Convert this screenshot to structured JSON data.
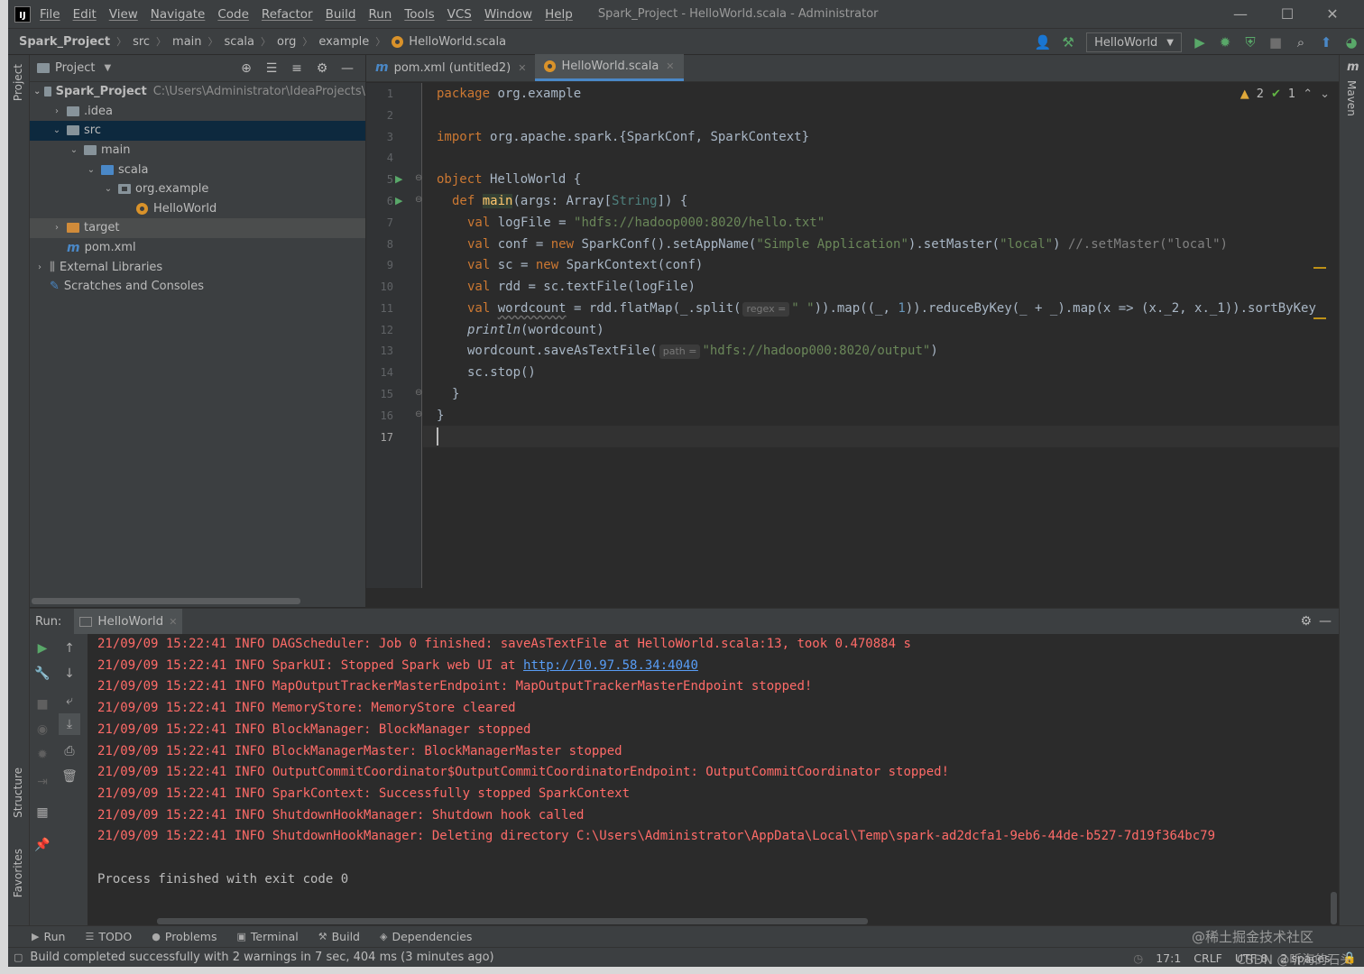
{
  "window": {
    "title": "Spark_Project - HelloWorld.scala - Administrator",
    "menu": [
      "File",
      "Edit",
      "View",
      "Navigate",
      "Code",
      "Refactor",
      "Build",
      "Run",
      "Tools",
      "VCS",
      "Window",
      "Help"
    ],
    "controls": {
      "minimize": "—",
      "maximize": "☐",
      "close": "✕"
    }
  },
  "breadcrumb": [
    "Spark_Project",
    "src",
    "main",
    "scala",
    "org",
    "example",
    "HelloWorld.scala"
  ],
  "toolbar": {
    "run_config": "HelloWorld"
  },
  "side_strips": {
    "left_top": "Project",
    "left_structure": "Structure",
    "left_favorites": "Favorites",
    "right": "Maven"
  },
  "project": {
    "title": "Project",
    "tree": [
      {
        "label": "Spark_Project",
        "path": "C:\\Users\\Administrator\\IdeaProjects\\"
      },
      {
        "label": ".idea"
      },
      {
        "label": "src"
      },
      {
        "label": "main"
      },
      {
        "label": "scala"
      },
      {
        "label": "org.example"
      },
      {
        "label": "HelloWorld"
      },
      {
        "label": "target"
      },
      {
        "label": "pom.xml"
      },
      {
        "label": "External Libraries"
      },
      {
        "label": "Scratches and Consoles"
      }
    ]
  },
  "editor": {
    "tabs": [
      {
        "label": "pom.xml (untitled2)"
      },
      {
        "label": "HelloWorld.scala"
      }
    ],
    "line_numbers": [
      "1",
      "2",
      "3",
      "4",
      "5",
      "6",
      "7",
      "8",
      "9",
      "10",
      "11",
      "12",
      "13",
      "14",
      "15",
      "16",
      "17"
    ],
    "inspections": {
      "warnings": "2",
      "ok": "1"
    },
    "code": {
      "l1a": "package",
      "l1b": " org.example",
      "l3a": "import",
      "l3b": " org.apache.spark.{SparkConf, SparkContext}",
      "l5a": "object",
      "l5b": " HelloWorld {",
      "l6a": "def",
      "l6b": "main",
      "l6c": "(args: Array[",
      "l6d": "String",
      "l6e": "]) {",
      "l7a": "val",
      "l7b": " logFile = ",
      "l7c": "\"hdfs://hadoop000:8020/hello.txt\"",
      "l8a": "val",
      "l8b": " conf = ",
      "l8c": "new",
      "l8d": " SparkConf().setAppName(",
      "l8e": "\"Simple Application\"",
      "l8f": ").setMaster(",
      "l8g": "\"local\"",
      "l8h": ") ",
      "l8i": "//.setMaster(\"local\")",
      "l9a": "val",
      "l9b": " sc = ",
      "l9c": "new",
      "l9d": " SparkContext(conf)",
      "l10a": "val",
      "l10b": " rdd = sc.textFile(logFile)",
      "l11a": "val",
      "l11b": "wordcount",
      "l11c": " = rdd.flatMap(_.split(",
      "l11hint": "regex =",
      "l11d": "\" \"",
      "l11e": ")).map((_, ",
      "l11f": "1",
      "l11g": ")).reduceByKey(_ + _).map(x => (x._2, x._1)).sortByKey",
      "l12a": "println",
      "l12b": "(wordcount)",
      "l13a": "wordcount.saveAsTextFile(",
      "l13hint": "path =",
      "l13b": "\"hdfs://hadoop000:8020/output\"",
      "l13c": ")",
      "l14a": "sc.stop()",
      "l15a": "}",
      "l16a": "}"
    }
  },
  "run_panel": {
    "label": "Run:",
    "tab": "HelloWorld",
    "logs": [
      "21/09/09 15:22:41 INFO DAGScheduler: Job 0 finished: saveAsTextFile at HelloWorld.scala:13, took 0.470884 s",
      "21/09/09 15:22:41 INFO MapOutputTrackerMasterEndpoint: MapOutputTrackerMasterEndpoint stopped!",
      "21/09/09 15:22:41 INFO MemoryStore: MemoryStore cleared",
      "21/09/09 15:22:41 INFO BlockManager: BlockManager stopped",
      "21/09/09 15:22:41 INFO BlockManagerMaster: BlockManagerMaster stopped",
      "21/09/09 15:22:41 INFO OutputCommitCoordinator$OutputCommitCoordinatorEndpoint: OutputCommitCoordinator stopped!",
      "21/09/09 15:22:41 INFO SparkContext: Successfully stopped SparkContext",
      "21/09/09 15:22:41 INFO ShutdownHookManager: Shutdown hook called",
      "21/09/09 15:22:41 INFO ShutdownHookManager: Deleting directory C:\\Users\\Administrator\\AppData\\Local\\Temp\\spark-ad2dcfa1-9eb6-44de-b527-7d19f364bc79"
    ],
    "sparkui_prefix": "21/09/09 15:22:41 INFO SparkUI: Stopped Spark web UI at ",
    "sparkui_link": "http://10.97.58.34:4040",
    "finished": "Process finished with exit code 0"
  },
  "bottom_tabs": [
    "Run",
    "TODO",
    "Problems",
    "Terminal",
    "Build",
    "Dependencies"
  ],
  "status": {
    "message": "Build completed successfully with 2 warnings in 7 sec, 404 ms (3 minutes ago)",
    "position": "17:1",
    "line_sep": "CRLF",
    "encoding": "UTF-8",
    "indent": "2 spaces"
  },
  "watermarks": {
    "juejin": "@稀土掘金技术社区",
    "csdn": "CSDN @听海的石头"
  }
}
